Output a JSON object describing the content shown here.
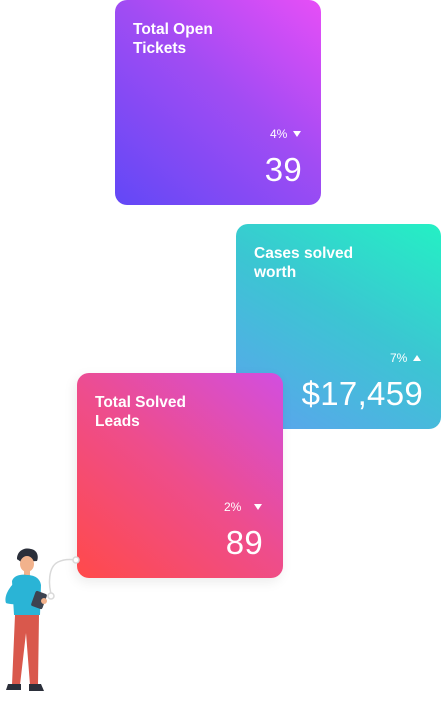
{
  "cards": {
    "open_tickets": {
      "title": "Total Open\nTickets",
      "change": "4%",
      "trend": "down",
      "value": "39"
    },
    "cases_worth": {
      "title": "Cases solved\nworth",
      "change": "7%",
      "trend": "up",
      "value": "$17,459"
    },
    "solved_leads": {
      "title": "Total Solved\nLeads",
      "change": "2%",
      "trend": "down",
      "value": "89"
    }
  },
  "icons": [
    "triangle-down-icon",
    "triangle-up-icon"
  ],
  "colors": {
    "open_tickets_gradient": [
      "#e74ef7",
      "#6248f6"
    ],
    "cases_worth_gradient": [
      "#24f0c4",
      "#5da2ef"
    ],
    "solved_leads_gradient": [
      "#ff4a4a",
      "#d24ee0"
    ]
  }
}
